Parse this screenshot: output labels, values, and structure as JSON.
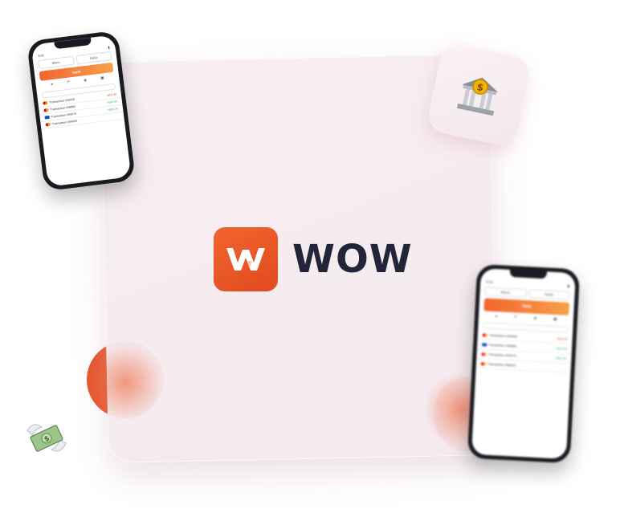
{
  "brand": {
    "name": "WOW",
    "accent": "#f2652f",
    "text_color": "#22253a"
  },
  "bank_icon": "bank-building-dollar-icon",
  "money_icon": "money-with-wings-icon",
  "phone": {
    "time": "9:41",
    "tab_left": "Menu",
    "tab_right": "Refer",
    "banner": "Valid",
    "transactions": [
      {
        "label": "Transaction #05059",
        "amount": "-$16.30",
        "card": "mastercard"
      },
      {
        "label": "Transaction #08882",
        "amount": "+$34.50",
        "card": "mastercard"
      },
      {
        "label": "Transaction #09070",
        "amount": "+$60.30",
        "card": "visa"
      },
      {
        "label": "Transaction #06653",
        "amount": "",
        "card": "mastercard"
      }
    ]
  }
}
